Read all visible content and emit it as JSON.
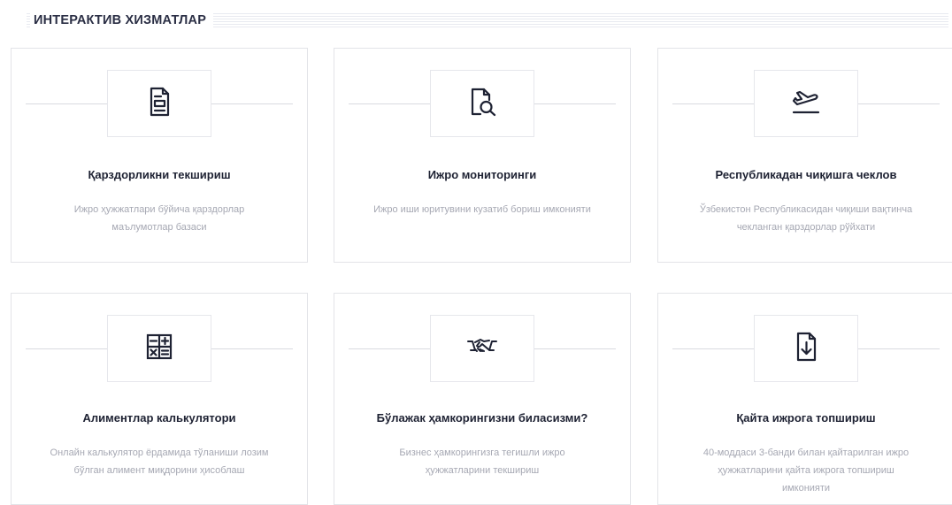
{
  "top_text": "",
  "section": {
    "title": "ИНТЕРАКТИВ ХИЗМАТЛАР"
  },
  "cards": [
    {
      "icon": "document-list-icon",
      "title": "Қарздорликни текшириш",
      "description": "Ижро ҳужжатлари бўйича қарздорлар маълумотлар базаси"
    },
    {
      "icon": "document-search-icon",
      "title": "Ижро мониторинги",
      "description": "Ижро иши юритувини кузатиб бориш имконияти"
    },
    {
      "icon": "airplane-takeoff-icon",
      "title": "Республикадан чиқишга чеклов",
      "description": "Ўзбекистон Республикасидан чиқиши вақтинча чекланган қарздорлар рўйхати"
    },
    {
      "icon": "calculator-icon",
      "title": "Алиментлар калькулятори",
      "description": "Онлайн калькулятор ёрдамида тўланиши лозим бўлган алимент миқдорини ҳисоблаш"
    },
    {
      "icon": "handshake-icon",
      "title": "Бўлажак ҳамкорингизни биласизми?",
      "description": "Бизнес ҳамкорингизга тегишли ижро ҳужжатларини текшириш"
    },
    {
      "icon": "document-download-icon",
      "title": "Қайта ижрога топшириш",
      "description": "40-моддаси 3-банди билан қайтарилган ижро ҳужжатларини қайта ижрога топшириш имконияти"
    }
  ]
}
